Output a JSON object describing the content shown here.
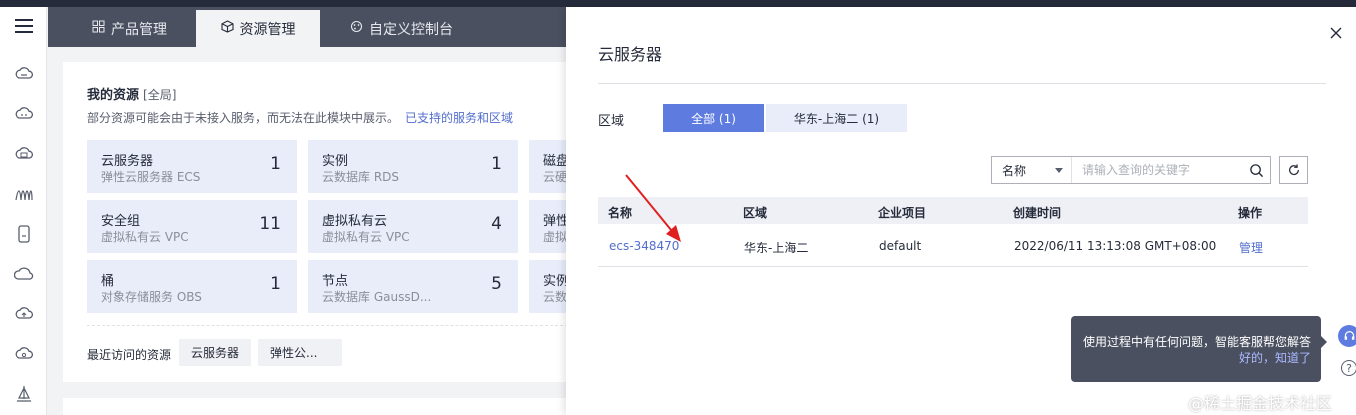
{
  "topbar": {
    "color": "#252b3a"
  },
  "leftnav": {
    "icons": [
      "menu-icon",
      "cloud-server-icon",
      "cloud-icon",
      "database-icon",
      "network-icon",
      "storage-icon",
      "cloud-outline-icon",
      "cloud-upload-icon",
      "cloud-settings-icon",
      "sailboat-icon"
    ]
  },
  "tabs": [
    {
      "label": "产品管理",
      "icon": "grid-icon",
      "active": false
    },
    {
      "label": "资源管理",
      "icon": "cube-icon",
      "active": true
    },
    {
      "label": "自定义控制台",
      "icon": "palette-icon",
      "active": false
    }
  ],
  "resources": {
    "title": "我的资源",
    "scope": "[全局]",
    "subtitle": "部分资源可能会由于未接入服务，而无法在此模块中展示。",
    "subtitle_link": "已支持的服务和区域",
    "items": [
      {
        "name": "云服务器",
        "sub": "弹性云服务器 ECS",
        "count": "1"
      },
      {
        "name": "实例",
        "sub": "云数据库 RDS",
        "count": "1"
      },
      {
        "name": "磁盘",
        "sub": "云硬",
        "count": ""
      },
      {
        "name": "安全组",
        "sub": "虚拟私有云 VPC",
        "count": "11"
      },
      {
        "name": "虚拟私有云",
        "sub": "虚拟私有云 VPC",
        "count": "4"
      },
      {
        "name": "弹性",
        "sub": "虚拟",
        "count": ""
      },
      {
        "name": "桶",
        "sub": "对象存储服务 OBS",
        "count": "1"
      },
      {
        "name": "节点",
        "sub": "云数据库 GaussD...",
        "count": "5"
      },
      {
        "name": "实例",
        "sub": "云数",
        "count": ""
      }
    ],
    "recent_label": "最近访问的资源",
    "recent": [
      "云服务器",
      "弹性公..."
    ]
  },
  "drawer": {
    "title": "云服务器",
    "region_label": "区域",
    "region_tabs": [
      {
        "label": "全部 (1)",
        "active": true
      },
      {
        "label": "华东-上海二 (1)",
        "active": false
      }
    ],
    "search": {
      "field": "名称",
      "placeholder": "请输入查询的关键字"
    },
    "columns": [
      "名称",
      "区域",
      "企业项目",
      "创建时间",
      "操作"
    ],
    "rows": [
      {
        "name": "ecs-348470",
        "region": "华东-上海二",
        "project": "default",
        "created": "2022/06/11 13:13:08 GMT+08:00",
        "action": "管理"
      }
    ]
  },
  "tooltip": {
    "message": "使用过程中有任何问题，智能客服帮您解答",
    "action": "好的，知道了"
  },
  "watermark": "@稀土掘金技术社区",
  "colors": {
    "accent": "#5e7ce0",
    "link": "#526ecc",
    "annotation_arrow": "#e02020"
  }
}
